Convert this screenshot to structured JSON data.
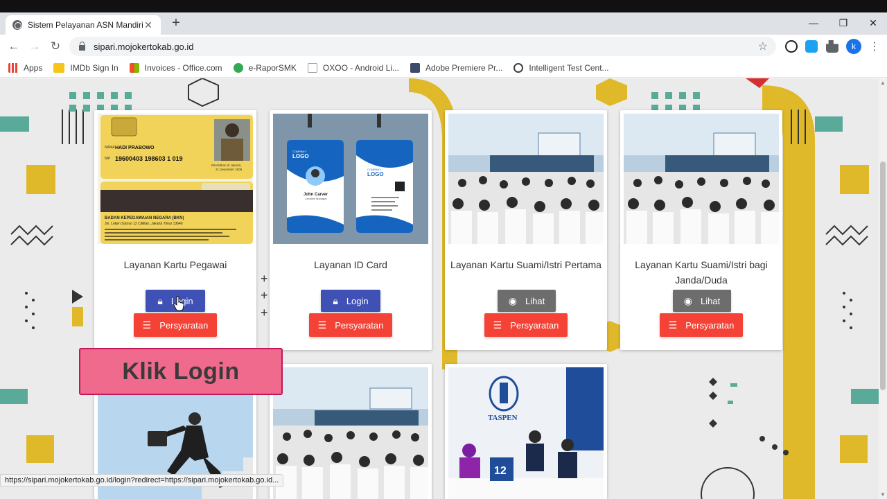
{
  "browser": {
    "tab_title": "Sistem Pelayanan ASN Mandiri",
    "tab_close": "✕",
    "new_tab": "+",
    "url": "sipari.mojokertokab.go.id",
    "avatar_letter": "k",
    "bookmarks": [
      "Apps",
      "IMDb Sign In",
      "Invoices - Office.com",
      "e-RaporSMK",
      "OXOO - Android Li...",
      "Adobe Premiere Pr...",
      "Intelligent Test Cent..."
    ]
  },
  "cards": [
    {
      "title": "Layanan Kartu Pegawai",
      "primary": "Login",
      "secondary": "Persyaratan"
    },
    {
      "title": "Layanan ID Card",
      "primary": "Login",
      "secondary": "Persyaratan"
    },
    {
      "title": "Layanan Kartu Suami/Istri Pertama",
      "primary": "Lihat",
      "secondary": "Persyaratan"
    },
    {
      "title": "Layanan Kartu Suami/Istri bagi Janda/Duda",
      "primary": "Lihat",
      "secondary": "Persyaratan"
    }
  ],
  "id_card": {
    "name": "HADI PRABOWO",
    "nip": "19600403 198603 1 019",
    "issued": "Diterbitkan di Jakarta,",
    "issued_date": "21 Desember 2009",
    "agency": "BADAN KEPEGAWAIAN NEGARA (BKN)",
    "address": "Jln. Letjen Sutoyo 12 Cililitan, Jakarta Timur 13640",
    "label_nama": "NAMA",
    "label_nip": "NIP"
  },
  "badge": {
    "company": "COMPANY",
    "logo": "LOGO",
    "person": "John Carver",
    "role": "Creative Manager"
  },
  "taspen": "TASPEN",
  "counter": "12",
  "overlay_label": "Klik Login",
  "status_url": "https://sipari.mojokertokab.go.id/login?redirect=https://sipari.mojokertokab.go.id..."
}
